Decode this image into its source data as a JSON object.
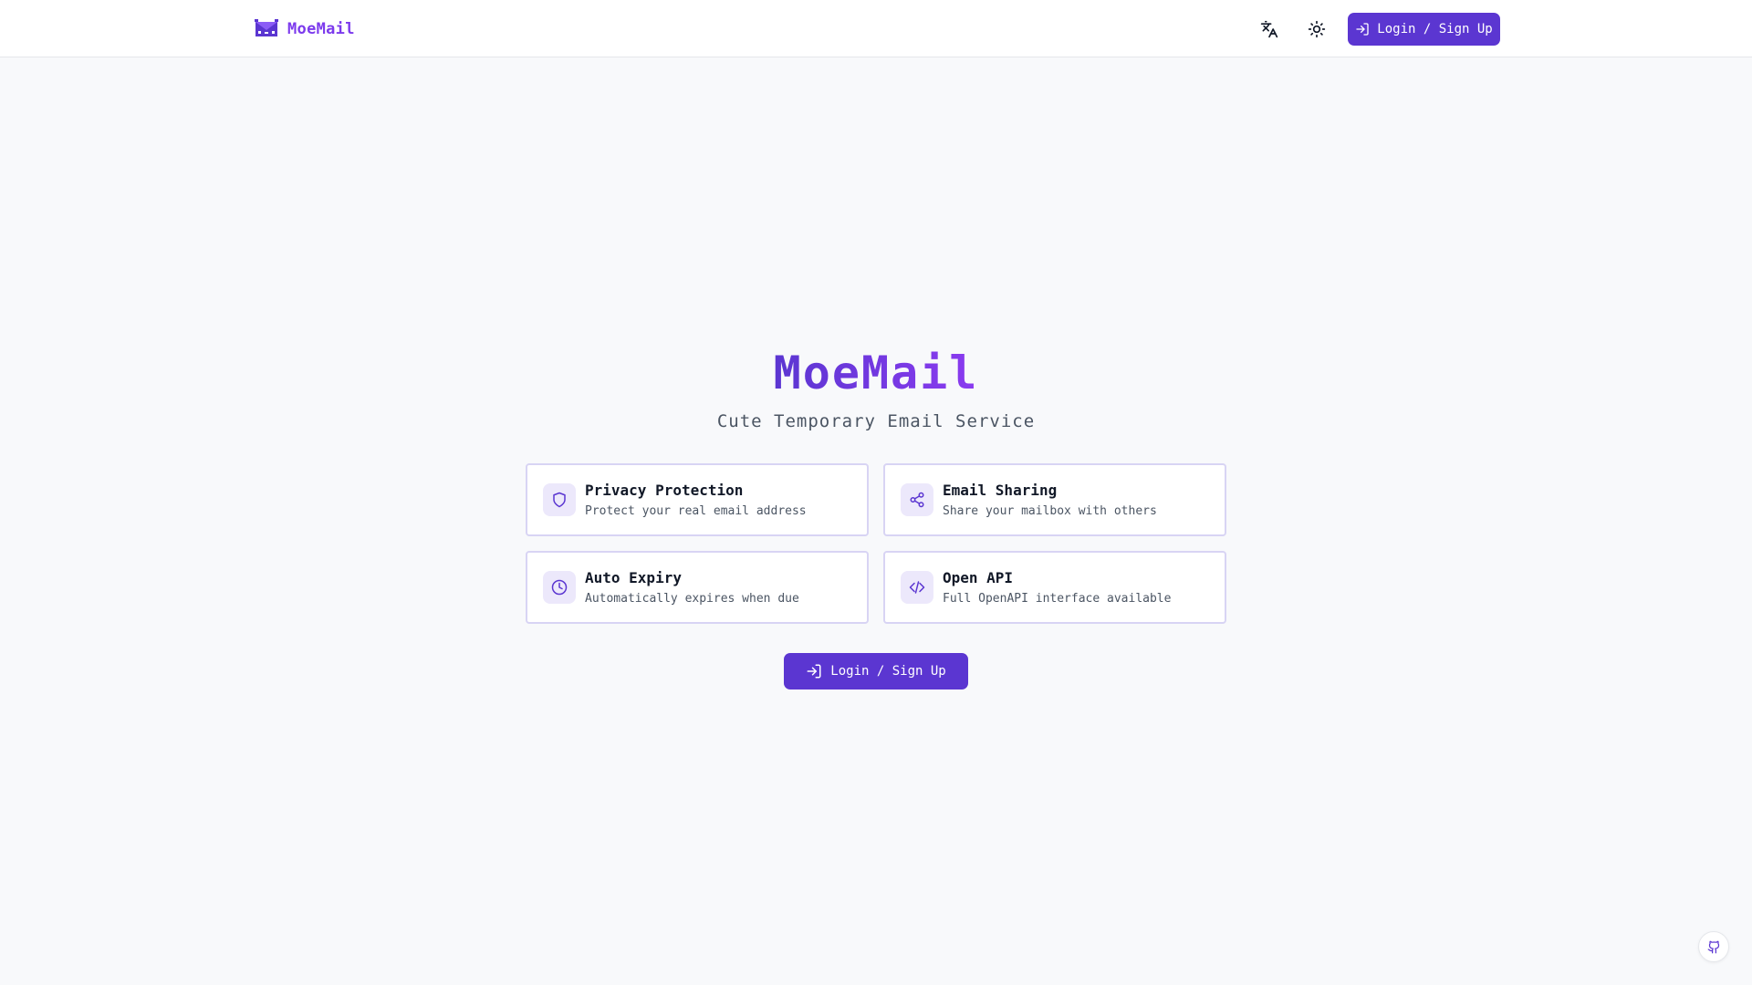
{
  "header": {
    "brand_name": "MoeMail",
    "logo_icon": "envelope-logo-icon",
    "translate_icon": "translate-icon",
    "theme_icon": "sun-icon",
    "login_label": "Login / Sign Up"
  },
  "hero": {
    "title": "MoeMail",
    "subtitle": "Cute Temporary Email Service"
  },
  "features": [
    {
      "icon": "shield-icon",
      "title": "Privacy Protection",
      "description": "Protect your real email address"
    },
    {
      "icon": "share-icon",
      "title": "Email Sharing",
      "description": "Share your mailbox with others"
    },
    {
      "icon": "clock-icon",
      "title": "Auto Expiry",
      "description": "Automatically expires when due"
    },
    {
      "icon": "code-icon",
      "title": "Open API",
      "description": "Full OpenAPI interface available"
    }
  ],
  "cta": {
    "login_label": "Login / Sign Up"
  },
  "footer": {
    "github_icon": "github-icon"
  },
  "colors": {
    "accent": "#5b36d1",
    "brand": "#7c3aed",
    "card_border": "#d8d4f4",
    "icon_bg": "#ece8fb",
    "background": "#f8f9fb"
  }
}
